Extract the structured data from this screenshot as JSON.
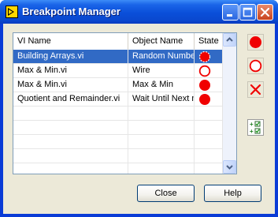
{
  "window": {
    "title": "Breakpoint Manager"
  },
  "list": {
    "columns": [
      "VI Name",
      "Object Name",
      "State"
    ],
    "rows": [
      {
        "vi": "Building Arrays.vi",
        "object": "Random Number",
        "state": "enabled-selected",
        "selected": true
      },
      {
        "vi": "Max & Min.vi",
        "object": "Wire",
        "state": "disabled",
        "selected": false
      },
      {
        "vi": "Max & Min.vi",
        "object": "Max & Min",
        "state": "enabled",
        "selected": false
      },
      {
        "vi": "Quotient and Remainder.vi",
        "object": "Wait Until Next m",
        "state": "enabled",
        "selected": false
      }
    ]
  },
  "side_buttons": [
    "enable-breakpoint-icon",
    "disable-breakpoint-icon",
    "clear-breakpoint-icon",
    "show-checked-icon"
  ],
  "buttons": {
    "close": "Close",
    "help": "Help"
  },
  "colors": {
    "breakpoint_red": "#f00000",
    "selection": "#316ac5",
    "titlebar": "#0a4fd9"
  }
}
